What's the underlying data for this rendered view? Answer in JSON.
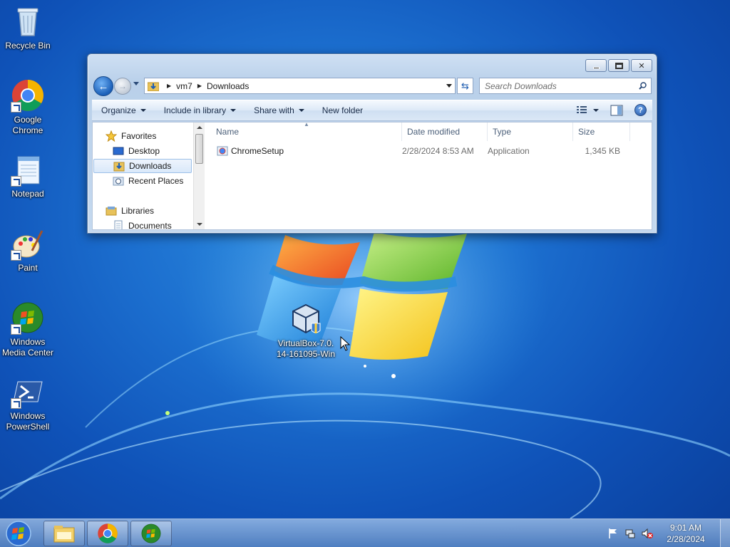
{
  "desktop": {
    "icons": [
      {
        "label": "Recycle Bin"
      },
      {
        "label": "Google Chrome"
      },
      {
        "label": "Notepad"
      },
      {
        "label": "Paint"
      },
      {
        "label": "Windows Media Center"
      },
      {
        "label": "Windows PowerShell"
      }
    ],
    "center_icon": {
      "label": "VirtualBox-7.0.14-161095-Win"
    }
  },
  "explorer": {
    "breadcrumb": [
      "vm7",
      "Downloads"
    ],
    "search_placeholder": "Search Downloads",
    "commands": {
      "organize": "Organize",
      "include_in_library": "Include in library",
      "share_with": "Share with",
      "new_folder": "New folder"
    },
    "nav_pane": {
      "favorites": "Favorites",
      "desktop": "Desktop",
      "downloads": "Downloads",
      "recent_places": "Recent Places",
      "libraries": "Libraries",
      "documents": "Documents"
    },
    "columns": {
      "name": "Name",
      "date_modified": "Date modified",
      "type": "Type",
      "size": "Size"
    },
    "files": [
      {
        "name": "ChromeSetup",
        "date_modified": "2/28/2024 8:53 AM",
        "type": "Application",
        "size": "1,345 KB"
      }
    ]
  },
  "taskbar": {
    "clock_time": "9:01 AM",
    "clock_date": "2/28/2024"
  },
  "colors": {
    "desktop_blue": "#1c6fcf",
    "selection": "#d9e8fa",
    "chrome_red": "#db4437",
    "chrome_green": "#0f9d58",
    "chrome_yellow": "#f4b400",
    "chrome_blue": "#4285f4"
  }
}
